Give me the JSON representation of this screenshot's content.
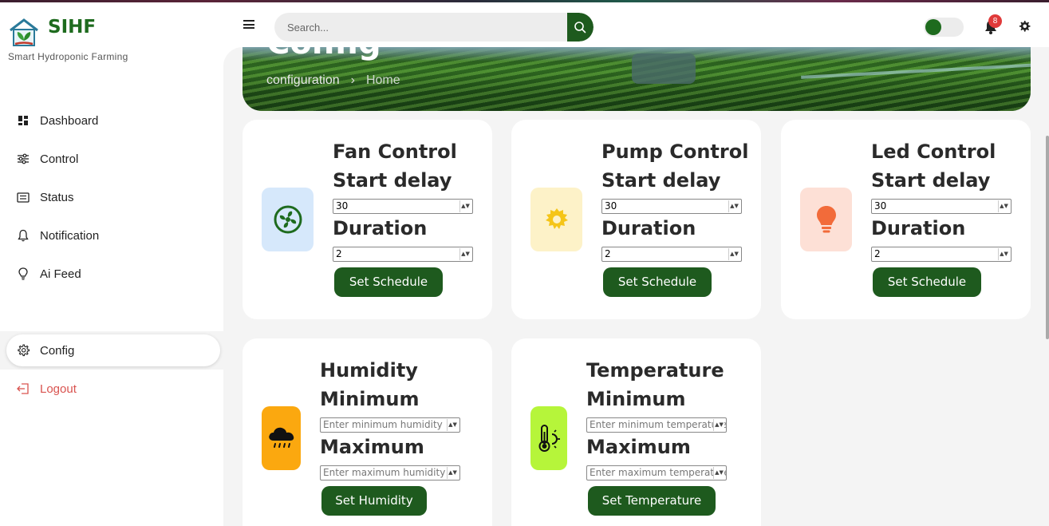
{
  "brand": {
    "name": "SIHF",
    "tagline": "Smart Hydroponic Farming"
  },
  "header": {
    "search_placeholder": "Search...",
    "notification_count": "8",
    "theme_toggle_on": true
  },
  "sidebar": {
    "items": [
      {
        "label": "Dashboard",
        "icon": "dashboard-icon"
      },
      {
        "label": "Control",
        "icon": "sliders-icon"
      },
      {
        "label": "Status",
        "icon": "card-list-icon"
      },
      {
        "label": "Notification",
        "icon": "bell-icon"
      },
      {
        "label": "Ai Feed",
        "icon": "lightbulb-icon"
      }
    ],
    "config": {
      "label": "Config",
      "icon": "gear-icon",
      "active": true
    },
    "logout": {
      "label": "Logout",
      "icon": "logout-icon"
    }
  },
  "banner": {
    "title": "Config",
    "breadcrumb": [
      "configuration",
      "Home"
    ]
  },
  "cards": {
    "fan": {
      "title": "Fan Control",
      "delay_label": "Start delay",
      "delay_value": "30",
      "duration_label": "Duration",
      "duration_value": "2",
      "button": "Set Schedule",
      "color": "#d6e8fb"
    },
    "pump": {
      "title": "Pump Control",
      "delay_label": "Start delay",
      "delay_value": "30",
      "duration_label": "Duration",
      "duration_value": "2",
      "button": "Set Schedule",
      "color": "#fdf2c8"
    },
    "led": {
      "title": "Led Control",
      "delay_label": "Start delay",
      "delay_value": "30",
      "duration_label": "Duration",
      "duration_value": "2",
      "button": "Set Schedule",
      "color": "#fde0d6"
    },
    "humidity": {
      "title": "Humidity",
      "min_label": "Minimum",
      "min_placeholder": "Enter minimum humidity",
      "max_label": "Maximum",
      "max_placeholder": "Enter maximum humidity",
      "button": "Set Humidity",
      "color": "#fba80f"
    },
    "temperature": {
      "title": "Temperature",
      "min_label": "Minimum",
      "min_placeholder": "Enter minimum temperature",
      "max_label": "Maximum",
      "max_placeholder": "Enter maximum temperature",
      "button": "Set Temperature",
      "color": "#b6f53a"
    }
  }
}
